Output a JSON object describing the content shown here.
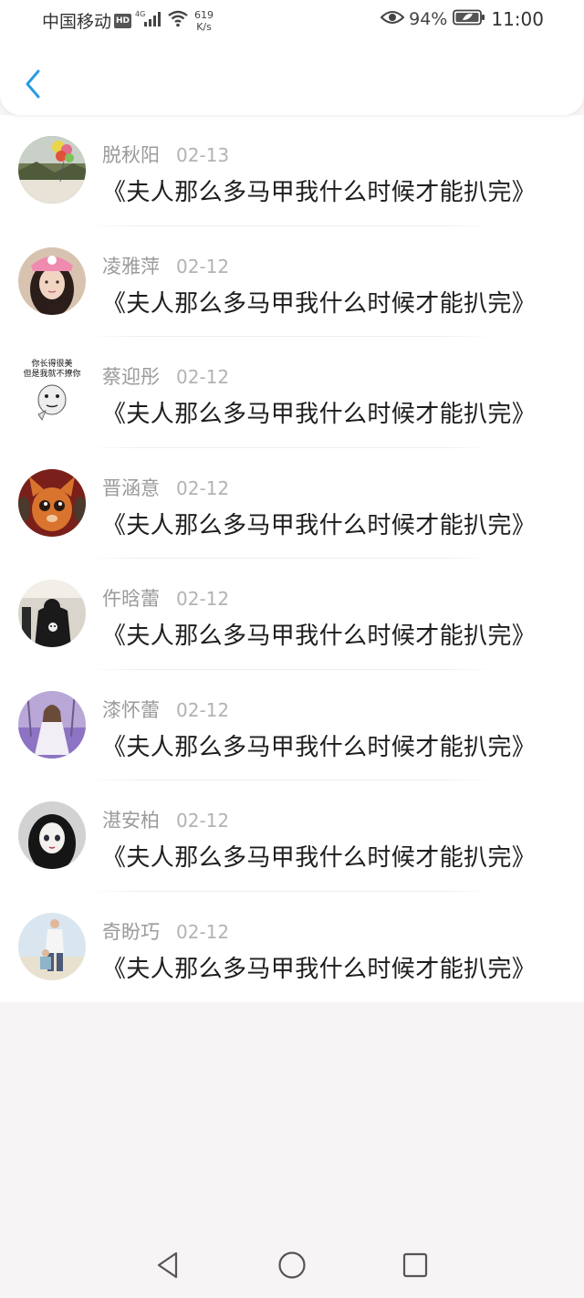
{
  "status_bar": {
    "carrier": "中国移动",
    "hd_badge": "HD",
    "network": "4G",
    "speed_value": "619",
    "speed_unit": "K/s",
    "battery_percent": "94%",
    "time": "11:00",
    "icons": [
      "hd-icon",
      "signal-icon",
      "wifi-icon",
      "eye-icon",
      "battery-icon"
    ]
  },
  "header": {
    "back_icon": "chevron-left-icon",
    "accent_color": "#2b9be0"
  },
  "comments": [
    {
      "username": "脱秋阳",
      "date": "02-13",
      "text": "《夫人那么多马甲我什么时候才能扒完》"
    },
    {
      "username": "凌雅萍",
      "date": "02-12",
      "text": "《夫人那么多马甲我什么时候才能扒完》"
    },
    {
      "username": "蔡迎彤",
      "date": "02-12",
      "text": "《夫人那么多马甲我什么时候才能扒完》",
      "avatar_caption": [
        "你长得很美",
        "但是我就不撩你"
      ]
    },
    {
      "username": "晋涵意",
      "date": "02-12",
      "text": "《夫人那么多马甲我什么时候才能扒完》"
    },
    {
      "username": "仵晗蕾",
      "date": "02-12",
      "text": "《夫人那么多马甲我什么时候才能扒完》"
    },
    {
      "username": "漆怀蕾",
      "date": "02-12",
      "text": "《夫人那么多马甲我什么时候才能扒完》"
    },
    {
      "username": "湛安柏",
      "date": "02-12",
      "text": "《夫人那么多马甲我什么时候才能扒完》"
    },
    {
      "username": "奇盼巧",
      "date": "02-12",
      "text": "《夫人那么多马甲我什么时候才能扒完》"
    }
  ],
  "nav_bar": {
    "icons": [
      "back-triangle-icon",
      "home-circle-icon",
      "recents-square-icon"
    ]
  }
}
